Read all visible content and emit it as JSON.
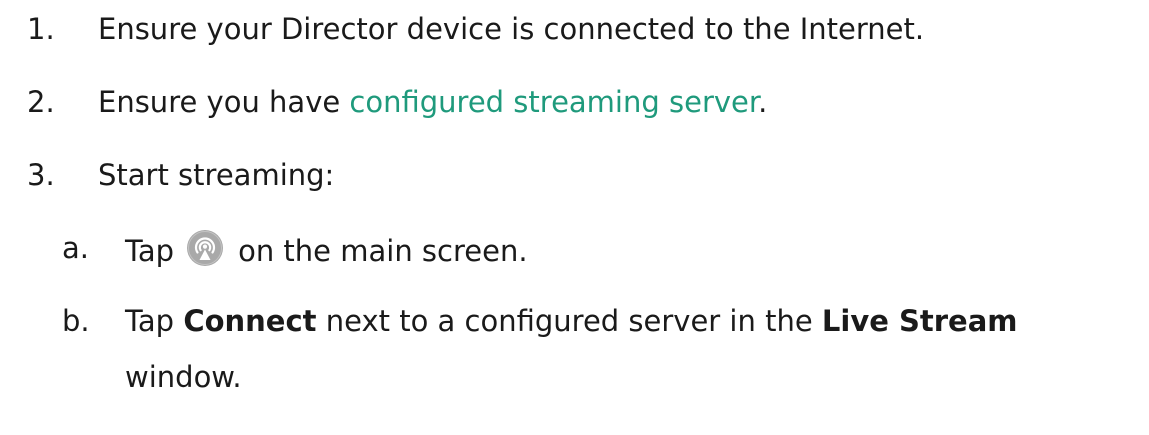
{
  "steps": [
    {
      "number": "1.",
      "text": "Ensure your Director device is connected to the Internet."
    },
    {
      "number": "2.",
      "text_before": "Ensure you have ",
      "link_text": "configured streaming server",
      "text_after": "."
    },
    {
      "number": "3.",
      "text": "Start streaming:"
    }
  ],
  "substeps": [
    {
      "letter": "a.",
      "text_before": "Tap",
      "icon": "live-stream-icon",
      "text_after": "on the main screen."
    },
    {
      "letter": "b.",
      "text_before": "Tap ",
      "bold1": "Connect",
      "text_middle": " next to a configured server in the ",
      "bold2": "Live Stream",
      "line2": "window."
    }
  ],
  "colors": {
    "link": "#1f9a7c",
    "text": "#1a1a1a",
    "icon": "#a9a9a9"
  }
}
